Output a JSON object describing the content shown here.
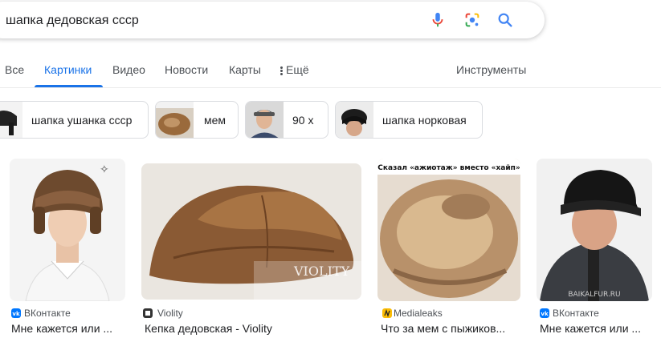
{
  "search": {
    "query": "шапка дедовская ссср"
  },
  "tabs": [
    {
      "label": "Все"
    },
    {
      "label": "Картинки"
    },
    {
      "label": "Видео"
    },
    {
      "label": "Новости"
    },
    {
      "label": "Карты"
    },
    {
      "label": "Ещё"
    }
  ],
  "tools_label": "Инструменты",
  "chips": [
    {
      "label": "шапка ушанка ссср"
    },
    {
      "label": "мем"
    },
    {
      "label": "90 х"
    },
    {
      "label": "шапка норковая"
    }
  ],
  "results": [
    {
      "source": "ВКонтакте",
      "title": "Мне кажется или ..."
    },
    {
      "source": "Violity",
      "title": "Кепка дедовская - Violity",
      "watermark": "VIOLITY"
    },
    {
      "source": "Medialeaks",
      "title": "Что за мем с пыжиков...",
      "caption": "Сказал «ажиотаж» вместо «хайп»"
    },
    {
      "source": "ВКонтакте",
      "title": "Мне кажется или ..."
    }
  ],
  "colors": {
    "accent": "#1a73e8",
    "vk": "#0077ff",
    "medialeaks": "#fbbc05"
  }
}
